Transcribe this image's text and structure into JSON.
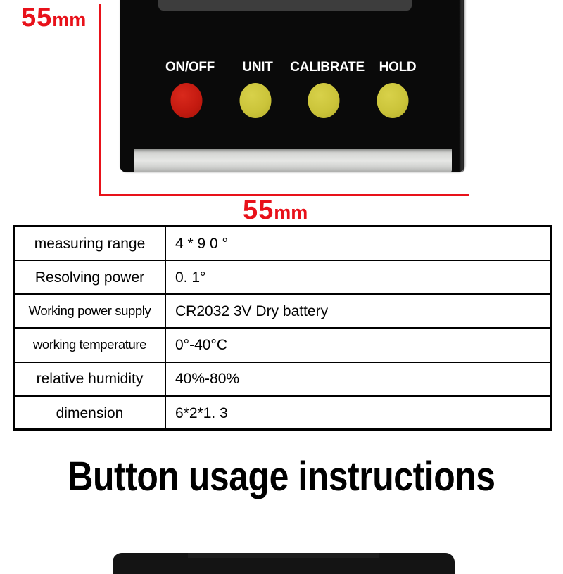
{
  "product_photo": {
    "dimension_left": {
      "value": "55",
      "unit": "mm"
    },
    "dimension_bottom": {
      "value": "55",
      "unit": "mm"
    },
    "guide_color": "#e8121a",
    "device": {
      "body_color": "#0a0a0a",
      "lcd_color": "#3d3d3d",
      "base_plate_color": "#d7d8d6",
      "buttons": [
        {
          "label": "ON/OFF",
          "color": "#c41a10",
          "kind": "power"
        },
        {
          "label": "UNIT",
          "color": "#cbc43a",
          "kind": "unit"
        },
        {
          "label": "CALIBRATE",
          "color": "#cbc43a",
          "kind": "calibrate"
        },
        {
          "label": "HOLD",
          "color": "#cbc43a",
          "kind": "hold"
        }
      ]
    }
  },
  "spec_table": {
    "rows": [
      {
        "key": "measuring range",
        "value": "4 * 9 0 °"
      },
      {
        "key": "Resolving power",
        "value": "0. 1°"
      },
      {
        "key": "Working power supply",
        "value": "CR2032 3V Dry battery"
      },
      {
        "key": "working temperature",
        "value": "0°-40°C"
      },
      {
        "key": "relative humidity",
        "value": "40%-80%"
      },
      {
        "key": "dimension",
        "value": "6*2*1. 3"
      }
    ]
  },
  "section_heading": "Button usage instructions"
}
